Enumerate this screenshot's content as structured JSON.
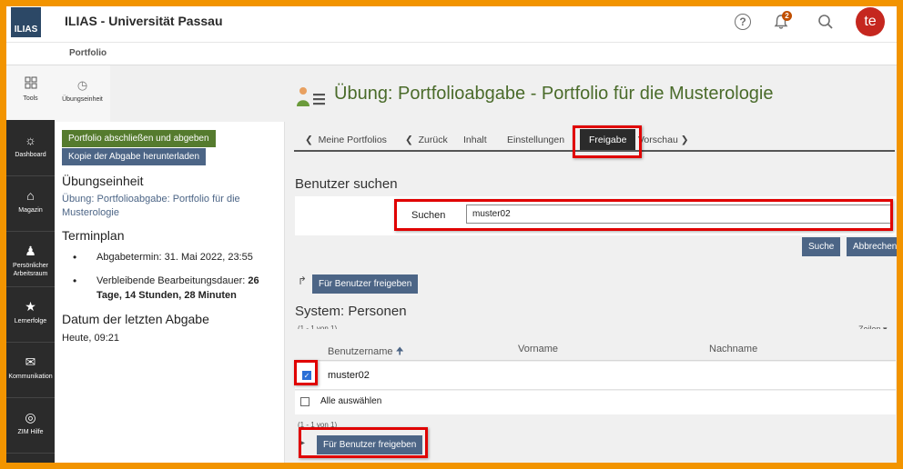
{
  "app": {
    "logo_text": "ILIAS",
    "title": "ILIAS - Universität Passau"
  },
  "header": {
    "help_glyph": "?",
    "notification_count": "2",
    "user_initials": "te"
  },
  "breadcrumb": {
    "label": "Portfolio"
  },
  "mainbar": [
    {
      "label": "Tools",
      "icon": "grid-icon"
    },
    {
      "label": "Dashboard",
      "icon": "dashboard-icon"
    },
    {
      "label": "Magazin",
      "icon": "bank-icon"
    },
    {
      "label": "Persönlicher Arbeitsraum",
      "icon": "person-icon"
    },
    {
      "label": "Lernerfolge",
      "icon": "trophy-icon"
    },
    {
      "label": "Kommunikation",
      "icon": "chat-icon"
    },
    {
      "label": "ZIM Hilfe",
      "icon": "lifebuoy-icon"
    }
  ],
  "slate": {
    "tab_label": "Übungseinheit",
    "btn_finish": "Portfolio abschließen und abgeben",
    "btn_download": "Kopie der Abgabe herunterladen",
    "h_unit": "Übungseinheit",
    "unit_link": "Übung: Portfolioabgabe: Portfolio für die Musterologie",
    "h_schedule": "Terminplan",
    "deadline_label": "Abgabetermin:",
    "deadline_value": "31. Mai 2022, 23:55",
    "remaining_label": "Verbleibende Bearbeitungsdauer:",
    "remaining_value": "26 Tage, 14 Stunden, 28 Minuten",
    "h_last": "Datum der letzten Abgabe",
    "last_value": "Heute, 09:21"
  },
  "main": {
    "title": "Übung: Portfolioabgabe - Portfolio für die Musterologie",
    "tabs": {
      "back_portfolios": "Meine Portfolios",
      "back": "Zurück",
      "content": "Inhalt",
      "settings": "Einstellungen",
      "share": "Freigabe",
      "preview": "Vorschau"
    },
    "search": {
      "heading": "Benutzer suchen",
      "label": "Suchen",
      "value": "muster02",
      "btn_search": "Suche",
      "btn_cancel": "Abbrechen"
    },
    "share_btn": "Für Benutzer freigeben",
    "table": {
      "heading": "System: Personen",
      "count": "(1 - 1 von 1)",
      "rows_label": "Zeilen",
      "columns": [
        "Benutzername",
        "Vorname",
        "Nachname"
      ],
      "rows": [
        {
          "username": "muster02",
          "firstname": "",
          "lastname": ""
        }
      ],
      "select_all": "Alle auswählen",
      "count_bottom": "(1 - 1 von 1)"
    }
  },
  "colors": {
    "frame": "#f29400",
    "highlight": "#e00000",
    "title_green": "#4a6b2a",
    "button_blue": "#4c6586",
    "button_green": "#557b2e"
  }
}
